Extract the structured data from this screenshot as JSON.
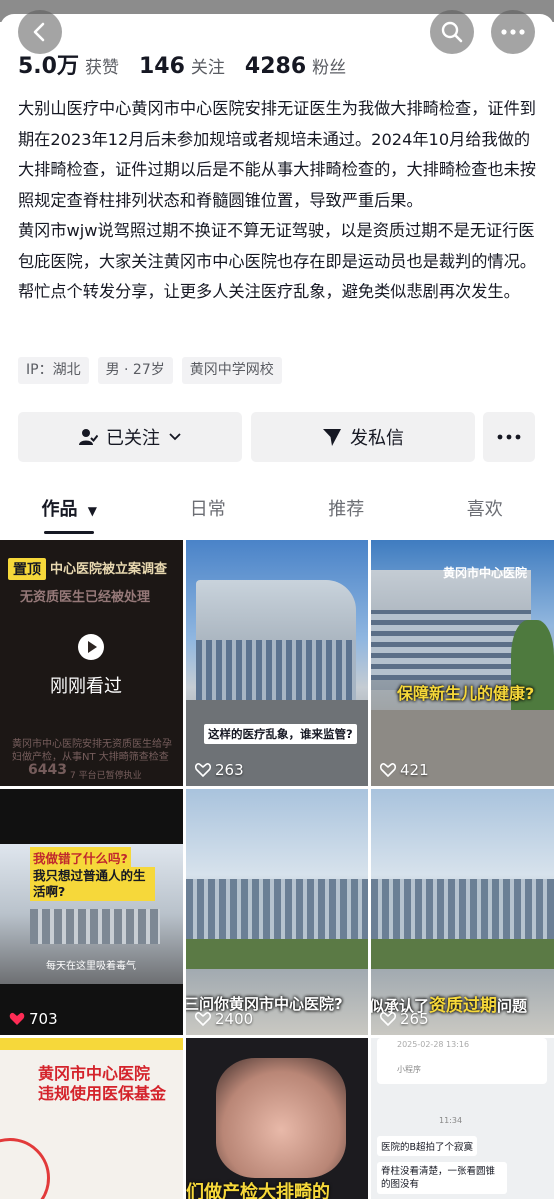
{
  "header": {
    "back_icon": "chevron-left-icon",
    "search_icon": "search-icon",
    "more_icon": "more-dots-icon"
  },
  "stats": {
    "likes_value": "5.0万",
    "likes_label": "获赞",
    "following_value": "146",
    "following_label": "关注",
    "followers_value": "4286",
    "followers_label": "粉丝"
  },
  "bio": {
    "paragraph1": "大别山医疗中心黄冈市中心医院安排无证医生为我做大排畸检查，证件到期在2023年12月后未参加规培或者规培未通过。2024年10月给我做的大排畸检查，证件过期以后是不能从事大排畸检查的，大排畸检查也未按照规定查脊柱排列状态和脊髓圆锥位置，导致严重后果。",
    "paragraph2": "黄冈市wjw说驾照过期不换证不算无证驾驶，以是资质过期不是无证行医包庇医院，大家关注黄冈市中心医院也存在即是运动员也是裁判的情况。帮忙点个转发分享，让更多人关注医疗乱象，避免类似悲剧再次发生。"
  },
  "tags": [
    "IP：湖北",
    "男 · 27岁",
    "黄冈中学网校"
  ],
  "actions": {
    "follow_label": "已关注",
    "message_label": "发私信"
  },
  "tabs": [
    "作品",
    "日常",
    "推荐",
    "喜欢"
  ],
  "videos": [
    {
      "pinned": "置顶",
      "title": "中心医院被立案调查",
      "subtitle": "无资质医生已经被处理",
      "overlay": "刚刚看过",
      "caption": "黄冈市中心医院安排无资质医生给孕妇做产检，从事NT 大排畸筛查检查",
      "count": "6443",
      "count_note": "7 平台已暂停执业"
    },
    {
      "caption": "这样的医疗乱象，谁来监管?",
      "likes": "263"
    },
    {
      "sign": "黄冈市中心医院",
      "caption": "保障新生儿的健康?",
      "likes": "421"
    },
    {
      "top_text": "我做错了什么吗?",
      "sub_text": "我只想过普通人的生活啊?",
      "bottom_text": "每天在这里吸着毒气",
      "likes": "703"
    },
    {
      "caption": "三问你黄冈市中心医院?",
      "likes": "2400"
    },
    {
      "caption_prefix": "似承认了",
      "caption_highlight": "资质过期",
      "caption_suffix": "问题",
      "likes": "265"
    },
    {
      "title1": "黄冈市中心医院",
      "title2": "违规使用医保基金"
    },
    {
      "caption": "们做产检大排畸的"
    },
    {
      "date": "2025-02-28 13:16",
      "mini": "小程序",
      "time": "11:34",
      "msg1": "医院的B超拍了个寂寞",
      "msg2": "脊柱没看清楚，一张看圆锥的图没有"
    }
  ],
  "colors": {
    "accent_dark": "#161823",
    "muted": "#5b5d63",
    "button_bg": "#f1f1f2",
    "highlight_yellow": "#f6d83a",
    "heart_red": "#fe2c55"
  }
}
